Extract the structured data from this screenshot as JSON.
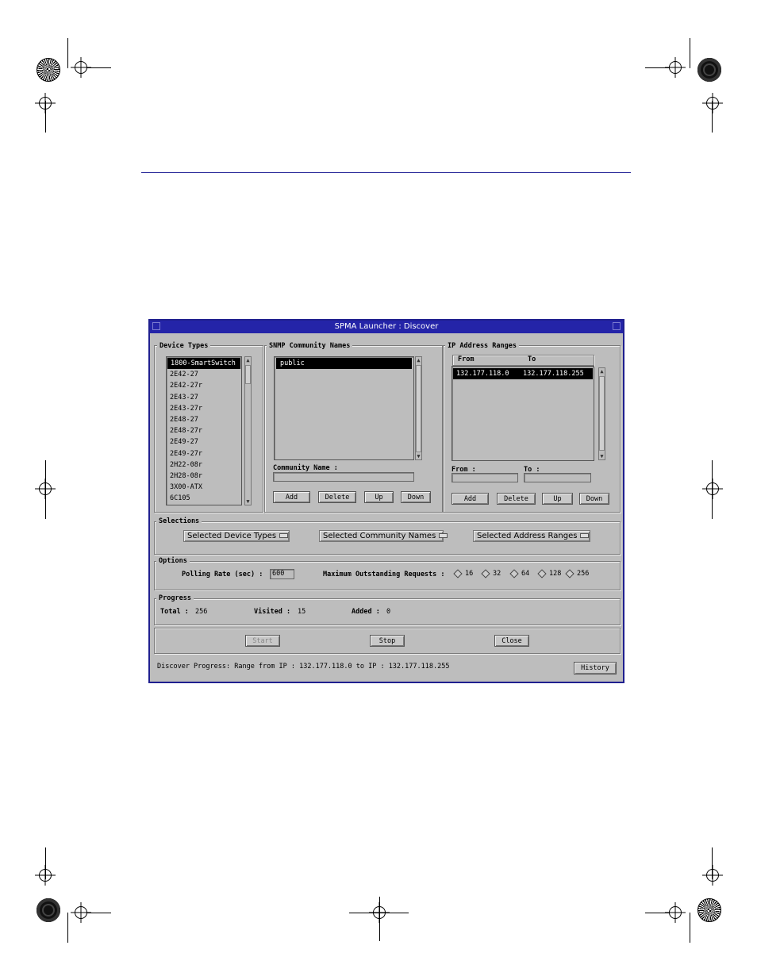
{
  "window": {
    "title": "SPMA Launcher : Discover"
  },
  "device_types": {
    "title": "Device Types",
    "items": [
      "1800-SmartSwitch",
      "2E42-27",
      "2E42-27r",
      "2E43-27",
      "2E43-27r",
      "2E48-27",
      "2E48-27r",
      "2E49-27",
      "2E49-27r",
      "2H22-08r",
      "2H28-08r",
      "3X00-ATX",
      "6C105"
    ],
    "selected_index": 0
  },
  "snmp": {
    "title": "SNMP Community Names",
    "items": [
      "public"
    ],
    "community_label": "Community Name :",
    "community_value": "",
    "buttons": {
      "add": "Add",
      "delete": "Delete",
      "up": "Up",
      "down": "Down"
    }
  },
  "ip_ranges": {
    "title": "IP Address Ranges",
    "col_from": "From",
    "col_to": "To",
    "rows": [
      {
        "from": "132.177.118.0",
        "to": "132.177.118.255"
      }
    ],
    "from_label": "From :",
    "to_label": "To :",
    "from_value": "",
    "to_value": "",
    "buttons": {
      "add": "Add",
      "delete": "Delete",
      "up": "Up",
      "down": "Down"
    }
  },
  "selections": {
    "title": "Selections",
    "device_types": "Selected Device Types",
    "community_names": "Selected Community Names",
    "address_ranges": "Selected Address Ranges"
  },
  "options": {
    "title": "Options",
    "polling_label": "Polling Rate (sec) :",
    "polling_value": "600",
    "max_label": "Maximum Outstanding Requests :",
    "choices": [
      "16",
      "32",
      "64",
      "128",
      "256"
    ]
  },
  "progress": {
    "title": "Progress",
    "total_label": "Total :",
    "total_value": "256",
    "visited_label": "Visited :",
    "visited_value": "15",
    "added_label": "Added :",
    "added_value": "0"
  },
  "actions": {
    "start": "Start",
    "stop": "Stop",
    "close": "Close"
  },
  "status": {
    "text": "Discover Progress: Range from IP : 132.177.118.0 to IP : 132.177.118.255",
    "history": "History"
  }
}
